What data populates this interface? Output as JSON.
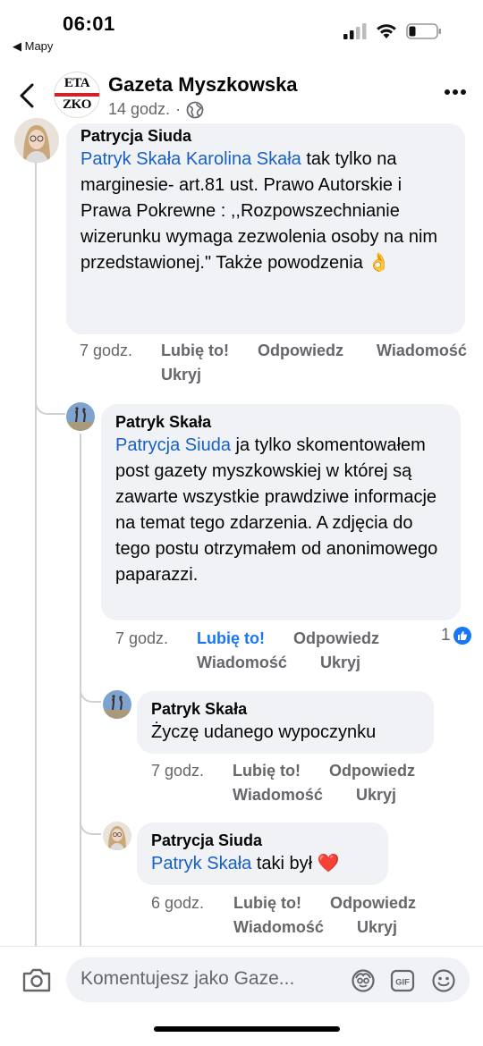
{
  "status_bar": {
    "time": "06:01",
    "back_app": "◀ Mapy"
  },
  "header": {
    "page_name": "Gazeta Myszkowska",
    "time_ago": "14 godz.",
    "separator": "·",
    "logo_top": "ETA",
    "logo_bottom": "ZKO"
  },
  "comments": [
    {
      "author": "Patrycja Siuda",
      "mentions": "Patryk Skała Karolina Skała",
      "text": " tak tylko na marginesie- art.81 ust. Prawo Autorskie i Prawa Pokrewne : ,,Rozpowszechnianie wizerunku wymaga zezwolenia osoby na nim przedstawionej.\" Także powodzenia",
      "emoji": "👌",
      "time": "7 godz.",
      "like": "Lubię to!",
      "reply": "Odpowiedz",
      "message": "Wiadomość",
      "hide": "Ukryj"
    },
    {
      "author": "Patryk Skała",
      "mentions": "Patrycja Siuda",
      "text": " ja tylko skomentowałem post gazety myszkowskiej w której są zawarte wszystkie prawdziwe informacje na temat tego zdarzenia. A zdjęcia do tego postu otrzymałem od anonimowego paparazzi.",
      "time": "7 godz.",
      "like": "Lubię to!",
      "reply": "Odpowiedz",
      "message": "Wiadomość",
      "hide": "Ukryj",
      "reaction_count": "1"
    },
    {
      "author": "Patryk Skała",
      "text": "Życzę udanego wypoczynku",
      "time": "7 godz.",
      "like": "Lubię to!",
      "reply": "Odpowiedz",
      "message": "Wiadomość",
      "hide": "Ukryj"
    },
    {
      "author": "Patrycja Siuda",
      "mentions": "Patryk Skała",
      "text": " taki był ",
      "emoji": "❤️",
      "time": "6 godz.",
      "like": "Lubię to!",
      "reply": "Odpowiedz",
      "message": "Wiadomość",
      "hide": "Ukryj"
    }
  ],
  "composer": {
    "placeholder": "Komentujesz jako Gaze..."
  },
  "colors": {
    "mention": "#1760c9",
    "liked": "#1877f2",
    "bubble": "#f0f2f5",
    "meta": "#65676b"
  }
}
